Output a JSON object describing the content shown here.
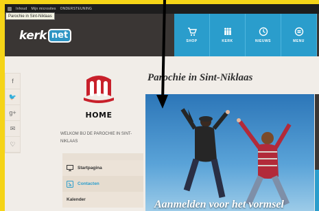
{
  "topbar": {
    "links": [
      "Inhoud",
      "Mijn microsites",
      "ONDERSTEUNING"
    ]
  },
  "tooltip": "Parochie in Sint-Niklaas",
  "logo": {
    "part1": "kerk",
    "part2": "net"
  },
  "nav": [
    {
      "label": "SHOP",
      "icon": "cart-icon"
    },
    {
      "label": "KERK",
      "icon": "people-icon"
    },
    {
      "label": "NIEUWS",
      "icon": "clock-icon"
    },
    {
      "label": "MENU",
      "icon": "menu-icon"
    }
  ],
  "social": [
    {
      "glyph": "f",
      "icon": "facebook-icon"
    },
    {
      "glyph": "🐦",
      "icon": "twitter-icon"
    },
    {
      "glyph": "g+",
      "icon": "googleplus-icon"
    },
    {
      "glyph": "✉",
      "icon": "mail-icon"
    },
    {
      "glyph": "♡",
      "icon": "heart-icon"
    }
  ],
  "home_logo": {
    "label": "HOME"
  },
  "welcome": "WELKOM BIJ DE PAROCHIE IN SINT-NIKLAAS",
  "sidemenu": [
    {
      "label": "Startpagina",
      "icon": "monitor-icon"
    },
    {
      "label": "Contacten",
      "icon": "contacts-icon"
    },
    {
      "label": "Kalender",
      "icon": ""
    }
  ],
  "page_title": "Parochie in Sint-Niklaas",
  "hero": {
    "caption": "Aanmelden voor het vormsel"
  },
  "colors": {
    "accent": "#2a9dcc",
    "header": "#3a3634",
    "frame": "#f5d417"
  }
}
